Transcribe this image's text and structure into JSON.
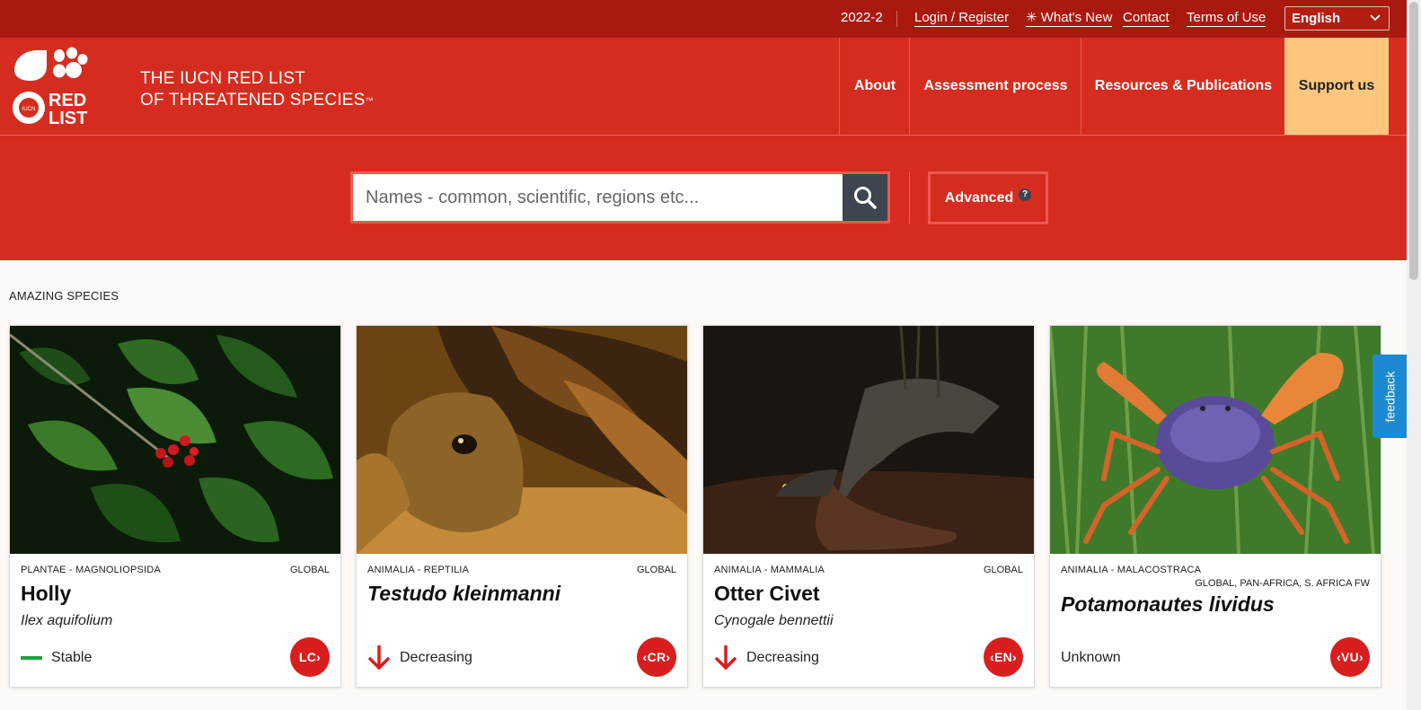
{
  "topbar": {
    "version": "2022-2",
    "login": "Login / Register",
    "whats_new": "✳ What's New",
    "contact": "Contact",
    "terms": "Terms of Use",
    "language": "English"
  },
  "header": {
    "brand_line1": "THE IUCN RED LIST",
    "brand_line2": "OF THREATENED SPECIES",
    "brand_tm": "™",
    "logo_text_1": "RED",
    "logo_text_2": "LIST",
    "logo_small": "IUCN",
    "nav": {
      "about": "About",
      "assessment": "Assessment process",
      "resources": "Resources & Publications",
      "support": "Support us"
    }
  },
  "search": {
    "placeholder": "Names - common, scientific, regions etc...",
    "advanced": "Advanced",
    "help": "?"
  },
  "section": {
    "title": "AMAZING SPECIES"
  },
  "cards": [
    {
      "kingdom": "PLANTAE - MAGNOLIOPSIDA",
      "scope": "GLOBAL",
      "name": "Holly",
      "scientific": "Ilex aquifolium",
      "trend": "Stable",
      "trend_icon": "stable-dash-icon",
      "status": "LC",
      "status_color": "#d81e1e"
    },
    {
      "kingdom": "ANIMALIA - REPTILIA",
      "scope": "GLOBAL",
      "name": "Testudo kleinmanni",
      "scientific": "",
      "trend": "Decreasing",
      "trend_icon": "arrow-down-icon",
      "status": "CR",
      "status_color": "#d81e1e"
    },
    {
      "kingdom": "ANIMALIA - MAMMALIA",
      "scope": "GLOBAL",
      "name": "Otter Civet",
      "scientific": "Cynogale bennettii",
      "trend": "Decreasing",
      "trend_icon": "arrow-down-icon",
      "status": "EN",
      "status_color": "#d81e1e"
    },
    {
      "kingdom": "ANIMALIA - MALACOSTRACA",
      "scope": "GLOBAL, PAN-AFRICA, S. AFRICA FW",
      "name": "Potamonautes lividus",
      "scientific": "",
      "trend": "Unknown",
      "trend_icon": "",
      "status": "VU",
      "status_color": "#d81e1e"
    }
  ],
  "feedback": "feedback",
  "colors": {
    "topbar": "#a9190f",
    "header": "#d62c1f",
    "support": "#ffc67e",
    "search_button": "#3c4550",
    "stable": "#1aa33c",
    "decreasing": "#d81e1e",
    "feedback": "#1b8ad2"
  }
}
